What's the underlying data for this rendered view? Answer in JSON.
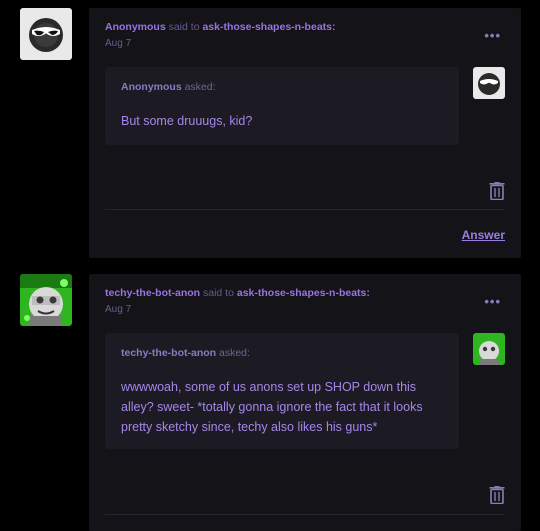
{
  "posts": [
    {
      "sender": "Anonymous",
      "said_to": "said to",
      "recipient": "ask-those-shapes-n-beats:",
      "date": "Aug 7",
      "asker": "Anonymous",
      "asked_label": "asked:",
      "message": "But some druuugs, kid?",
      "answer_label": "Answer",
      "menu": "•••"
    },
    {
      "sender": "techy-the-bot-anon",
      "said_to": "said to",
      "recipient": "ask-those-shapes-n-beats:",
      "date": "Aug 7",
      "asker": "techy-the-bot-anon",
      "asked_label": "asked:",
      "message": "wwwwoah, some of us anons set up SHOP down this alley? sweet- *totally gonna ignore the fact that it looks pretty sketchy since, techy also likes his guns*",
      "menu": "•••"
    }
  ],
  "colors": {
    "page_bg": "#000000",
    "card_bg": "#141418",
    "ask_bg": "#1c1b23",
    "accent": "#9b72e3"
  }
}
